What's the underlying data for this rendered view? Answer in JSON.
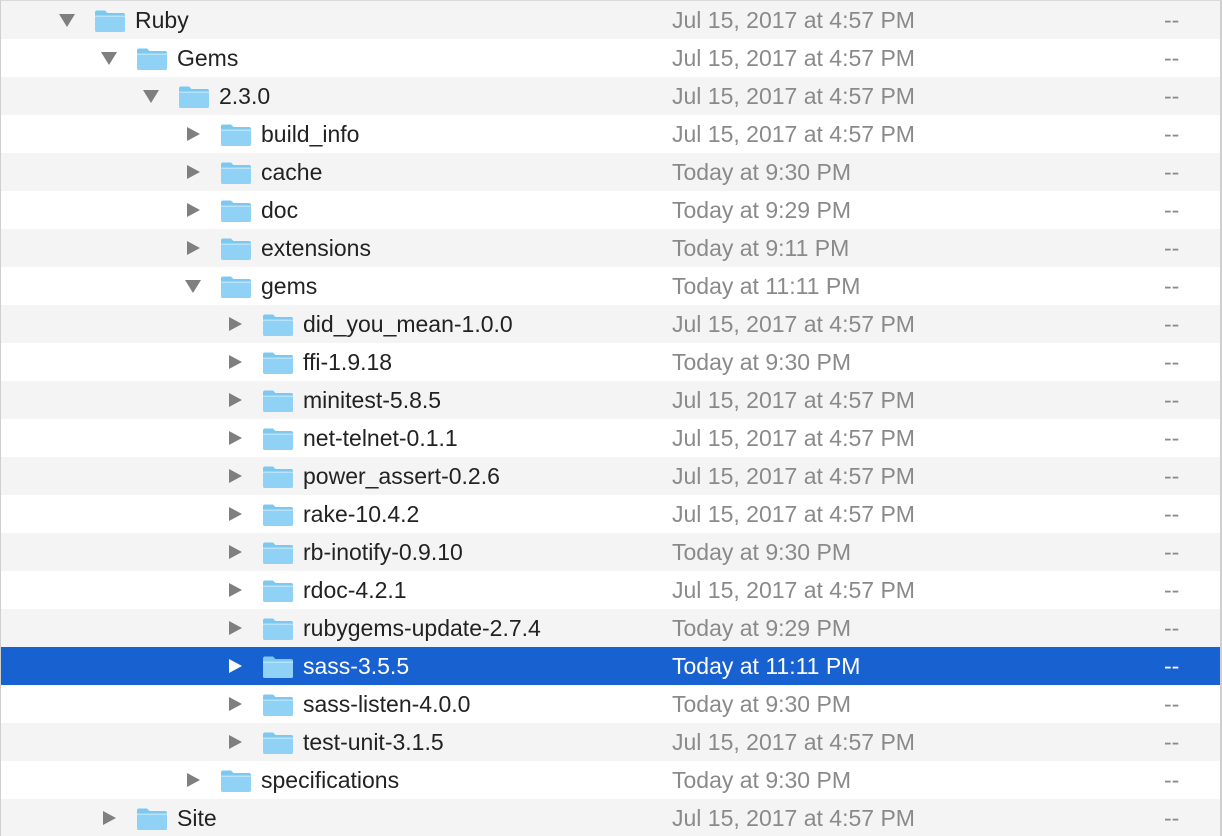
{
  "file_list": {
    "rows": [
      {
        "name": "Ruby",
        "date": "Jul 15, 2017 at 4:57 PM",
        "size": "--"
      },
      {
        "name": "Gems",
        "date": "Jul 15, 2017 at 4:57 PM",
        "size": "--"
      },
      {
        "name": "2.3.0",
        "date": "Jul 15, 2017 at 4:57 PM",
        "size": "--"
      },
      {
        "name": "build_info",
        "date": "Jul 15, 2017 at 4:57 PM",
        "size": "--"
      },
      {
        "name": "cache",
        "date": "Today at 9:30 PM",
        "size": "--"
      },
      {
        "name": "doc",
        "date": "Today at 9:29 PM",
        "size": "--"
      },
      {
        "name": "extensions",
        "date": "Today at 9:11 PM",
        "size": "--"
      },
      {
        "name": "gems",
        "date": "Today at 11:11 PM",
        "size": "--"
      },
      {
        "name": "did_you_mean-1.0.0",
        "date": "Jul 15, 2017 at 4:57 PM",
        "size": "--"
      },
      {
        "name": "ffi-1.9.18",
        "date": "Today at 9:30 PM",
        "size": "--"
      },
      {
        "name": "minitest-5.8.5",
        "date": "Jul 15, 2017 at 4:57 PM",
        "size": "--"
      },
      {
        "name": "net-telnet-0.1.1",
        "date": "Jul 15, 2017 at 4:57 PM",
        "size": "--"
      },
      {
        "name": "power_assert-0.2.6",
        "date": "Jul 15, 2017 at 4:57 PM",
        "size": "--"
      },
      {
        "name": "rake-10.4.2",
        "date": "Jul 15, 2017 at 4:57 PM",
        "size": "--"
      },
      {
        "name": "rb-inotify-0.9.10",
        "date": "Today at 9:30 PM",
        "size": "--"
      },
      {
        "name": "rdoc-4.2.1",
        "date": "Jul 15, 2017 at 4:57 PM",
        "size": "--"
      },
      {
        "name": "rubygems-update-2.7.4",
        "date": "Today at 9:29 PM",
        "size": "--"
      },
      {
        "name": "sass-3.5.5",
        "date": "Today at 11:11 PM",
        "size": "--"
      },
      {
        "name": "sass-listen-4.0.0",
        "date": "Today at 9:30 PM",
        "size": "--"
      },
      {
        "name": "test-unit-3.1.5",
        "date": "Jul 15, 2017 at 4:57 PM",
        "size": "--"
      },
      {
        "name": "specifications",
        "date": "Today at 9:30 PM",
        "size": "--"
      },
      {
        "name": "Site",
        "date": "Jul 15, 2017 at 4:57 PM",
        "size": "--"
      }
    ]
  },
  "icons": {
    "folder": "folder-icon",
    "expanded": "disclosure-expanded-icon",
    "collapsed": "disclosure-collapsed-icon"
  },
  "colors": {
    "selection": "#1761d1",
    "folder_fill": "#8fd2f5",
    "folder_tab": "#7ec8ef",
    "alt_row": "#f4f4f4",
    "secondary_text": "#8a8a8a"
  }
}
